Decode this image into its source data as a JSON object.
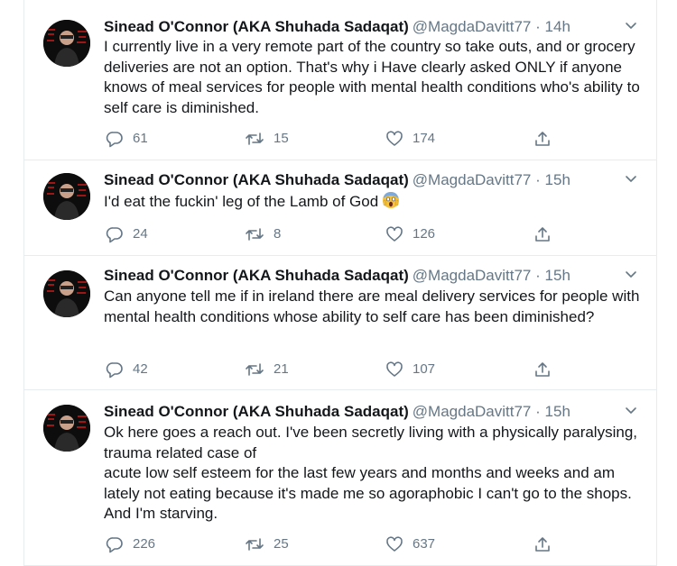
{
  "tweets": [
    {
      "name": "Sinead O'Connor (AKA Shuhada Sadaqat)",
      "handle": "@MagdaDavitt77",
      "sep": "·",
      "time": "14h",
      "text": "I currently live in a very remote part of the country so take outs, and or grocery deliveries are not an option.  That's why i Have clearly asked ONLY if anyone knows of meal services for people with mental health conditions who's ability to self care is diminished.",
      "replies": "61",
      "retweets": "15",
      "likes": "174"
    },
    {
      "name": "Sinead O'Connor (AKA Shuhada Sadaqat)",
      "handle": "@MagdaDavitt77",
      "sep": "·",
      "time": "15h",
      "text": "I'd eat the fuckin' leg of the Lamb of God",
      "emoji": "screaming-face-emoji",
      "replies": "24",
      "retweets": "8",
      "likes": "126"
    },
    {
      "name": "Sinead O'Connor (AKA Shuhada Sadaqat)",
      "handle": "@MagdaDavitt77",
      "sep": "·",
      "time": "15h",
      "text": "Can anyone tell me if in ireland there are meal delivery services for people with mental health conditions whose ability to self care has been diminished?",
      "replies": "42",
      "retweets": "21",
      "likes": "107"
    },
    {
      "name": "Sinead O'Connor (AKA Shuhada Sadaqat)",
      "handle": "@MagdaDavitt77",
      "sep": "·",
      "time": "15h",
      "text": "Ok here goes a reach out. I've been secretly living with a physically paralysing, trauma related case of\nacute low self esteem for the last few years and months and weeks and am lately not eating because it's made me so agoraphobic I can't go to the shops.  And I'm starving.",
      "replies": "226",
      "retweets": "25",
      "likes": "637"
    }
  ],
  "icons": {
    "reply": "reply-icon",
    "retweet": "retweet-icon",
    "like": "heart-icon",
    "share": "share-icon",
    "menu": "chevron-down-icon",
    "avatar": "avatar"
  },
  "colors": {
    "text": "#14171a",
    "secondary": "#657786",
    "border": "#e6ecf0"
  }
}
